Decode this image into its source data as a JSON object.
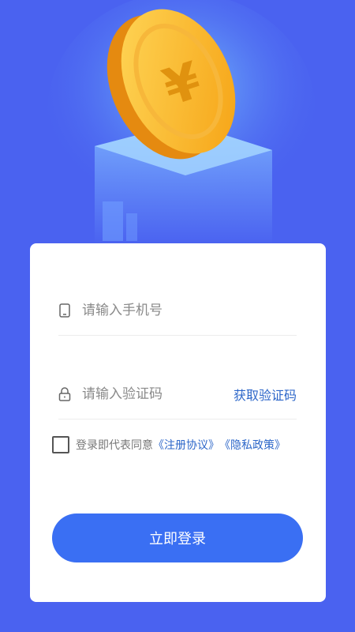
{
  "hero": {
    "icon": "yen-coin-icon"
  },
  "form": {
    "phone_placeholder": "请输入手机号",
    "code_placeholder": "请输入验证码",
    "get_code_label": "获取验证码",
    "agree_text": "登录即代表同意",
    "register_agreement": "《注册协议》",
    "privacy_policy": "《隐私政策》",
    "login_button": "立即登录"
  },
  "colors": {
    "background": "#4a62f0",
    "accent": "#3a6ff3",
    "link": "#2d67c9"
  }
}
